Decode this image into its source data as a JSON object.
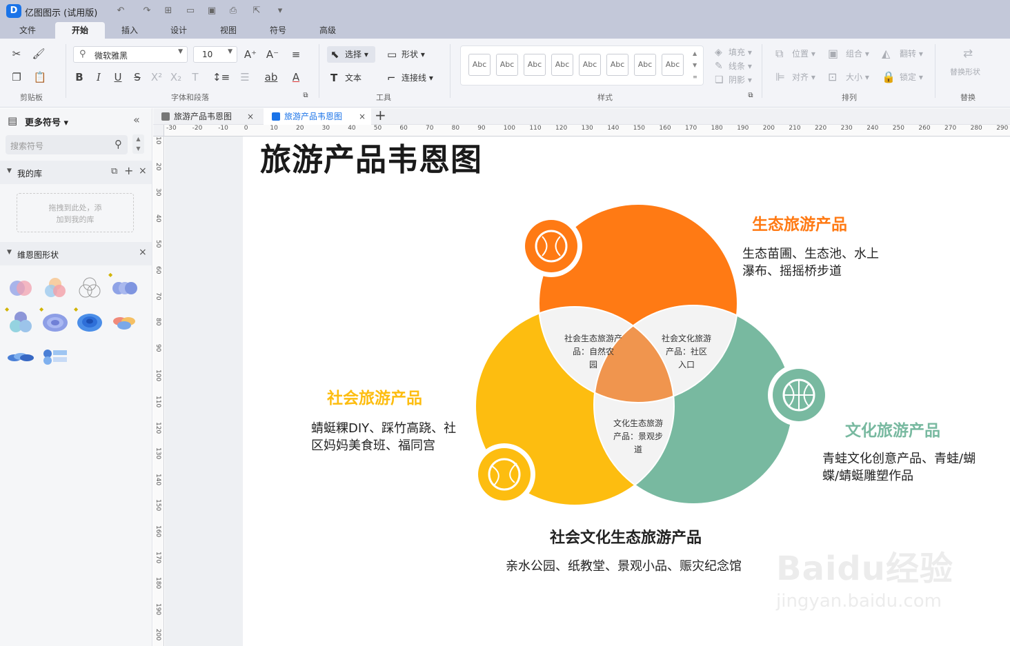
{
  "app": {
    "title": "亿图图示 (试用版)",
    "logo": "D"
  },
  "quick_access": [
    "undo-icon",
    "redo-icon",
    "new-icon",
    "open-icon",
    "save-icon",
    "print-icon",
    "export-icon",
    "more-icon"
  ],
  "menu_tabs": [
    "文件",
    "开始",
    "插入",
    "设计",
    "视图",
    "符号",
    "高级"
  ],
  "ribbon": {
    "font_name": "微软雅黑",
    "font_size": "10",
    "select_label": "选择",
    "shape_label": "形状",
    "text_label": "文本",
    "connector_label": "连接线",
    "style_abc": [
      "Abc",
      "Abc",
      "Abc",
      "Abc",
      "Abc",
      "Abc",
      "Abc",
      "Abc"
    ],
    "fill_label": "填充",
    "line_label": "线条",
    "shadow_label": "阴影",
    "position_label": "位置",
    "group_label": "组合",
    "flip_label": "翻转",
    "align_label": "对齐",
    "size_label": "大小",
    "lock_label": "锁定",
    "replace_shape_label": "替换形状",
    "groups": {
      "clipboard": "剪贴板",
      "font_para": "字体和段落",
      "tools": "工具",
      "styles": "样式",
      "arrange": "排列",
      "replace": "替换"
    }
  },
  "left_panel": {
    "title": "更多符号",
    "search_placeholder": "搜索符号",
    "my_library": "我的库",
    "drop_hint_1": "拖拽到此处，添",
    "drop_hint_2": "加到我的库",
    "venn_shapes": "维恩图形状"
  },
  "doc_tabs": [
    {
      "label": "旅游产品韦恩图",
      "active": false
    },
    {
      "label": "旅游产品韦恩图",
      "active": true
    }
  ],
  "ruler": {
    "h_ticks": [
      "-30",
      "-20",
      "-10",
      "0",
      "10",
      "20",
      "30",
      "40",
      "50",
      "60",
      "70",
      "80",
      "90",
      "100",
      "110",
      "120",
      "130",
      "140",
      "150",
      "160",
      "170",
      "180",
      "190",
      "200",
      "210",
      "220",
      "230",
      "240",
      "250",
      "260",
      "270",
      "280",
      "290"
    ],
    "v_ticks": [
      "10",
      "20",
      "30",
      "40",
      "50",
      "60",
      "70",
      "80",
      "90",
      "100",
      "110",
      "120",
      "130",
      "140",
      "150",
      "160",
      "170",
      "180",
      "190",
      "200"
    ]
  },
  "diagram": {
    "title": "旅游产品韦恩图",
    "eco": {
      "title": "生态旅游产品",
      "desc_1": "生态苗圃、生态池、水上",
      "desc_2": "瀑布、摇摇桥步道",
      "color": "#FF7A14"
    },
    "social": {
      "title": "社会旅游产品",
      "desc_1": "蜻蜓粿DIY、踩竹高跷、社",
      "desc_2": "区妈妈美食班、福同宫",
      "color": "#FDBD10"
    },
    "culture": {
      "title": "文化旅游产品",
      "desc_1": "青蛙文化创意产品、青蛙/蝴",
      "desc_2": "蝶/蜻蜓雕塑作品",
      "color": "#78B9A0"
    },
    "overlap_social_eco": [
      "社会生态旅游产",
      "品：自然农",
      "园"
    ],
    "overlap_culture_eco": [
      "社会文化旅游",
      "产品：社区",
      "入口"
    ],
    "overlap_culture_social": [
      "文化生态旅游",
      "产品：景观步",
      "道"
    ],
    "center": {
      "title": "社会文化生态旅游产品",
      "desc": "亲水公园、纸教堂、景观小品、赈灾纪念馆",
      "color": "#F0954E"
    }
  },
  "watermark": {
    "main": "Baidu经验",
    "sub": "jingyan.baidu.com"
  }
}
